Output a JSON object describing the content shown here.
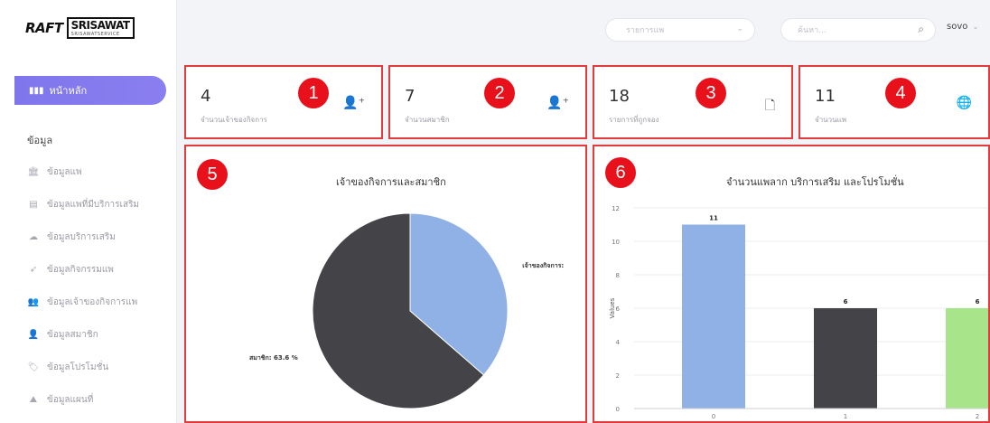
{
  "logo": {
    "raft": "RAFT",
    "brand": "SRISAWAT",
    "sub": "SRISAWATSERVICE"
  },
  "sidebar": {
    "home": {
      "icon": "bar-chart-icon",
      "label": "หน้าหลัก"
    },
    "section": "ข้อมูล",
    "items": [
      {
        "icon": "bank-icon",
        "label": "ข้อมูลแพ"
      },
      {
        "icon": "document-icon",
        "label": "ข้อมูลแพที่มีบริการเสริม"
      },
      {
        "icon": "cloud-icon",
        "label": "ข้อมูลบริการเสริม"
      },
      {
        "icon": "rocket-icon",
        "label": "ข้อมูลกิจกรรมแพ"
      },
      {
        "icon": "users-icon",
        "label": "ข้อมูลเจ้าของกิจการแพ"
      },
      {
        "icon": "user-icon",
        "label": "ข้อมูลสมาชิก"
      },
      {
        "icon": "tag-icon",
        "label": "ข้อมูลโปรโมชั่น"
      },
      {
        "icon": "map-icon",
        "label": "ข้อมูลแผนที่"
      }
    ]
  },
  "topbar": {
    "select_value": "รายการแพ",
    "search_placeholder": "ค้นหา...",
    "user": "sovo"
  },
  "stats": [
    {
      "badge": "1",
      "value": "4",
      "label": "จำนวนเจ้าของกิจการ",
      "icon": "user-plus-icon"
    },
    {
      "badge": "2",
      "value": "7",
      "label": "จำนวนสมาชิก",
      "icon": "user-plus-icon"
    },
    {
      "badge": "3",
      "value": "18",
      "label": "รายการที่ถูกจอง",
      "icon": "file-plus-icon"
    },
    {
      "badge": "4",
      "value": "11",
      "label": "จำนวนแพ",
      "icon": "globe-icon"
    }
  ],
  "pie": {
    "badge": "5",
    "chart_data": {
      "type": "pie",
      "title": "เจ้าของกิจการและสมาชิก",
      "slices": [
        {
          "name": "เจ้าของกิจการ:",
          "value": 36.4,
          "color": "#8fb1e6"
        },
        {
          "name": "สมาชิก",
          "value": 63.6,
          "color": "#434348"
        }
      ],
      "labels": [
        "เจ้าของกิจการ:",
        "สมาชิก: 63.6 %"
      ]
    }
  },
  "bar": {
    "badge": "6",
    "chart_data": {
      "type": "bar",
      "title": "จำนวนแพลาก บริการเสริม และโปรโมชั่น",
      "ylabel": "Values",
      "categories": [
        "0",
        "1",
        "2"
      ],
      "values": [
        11,
        6,
        6
      ],
      "colors": [
        "#8fb1e6",
        "#434348",
        "#a8e48a"
      ],
      "ylim": [
        0,
        12
      ],
      "yticks": [
        "0",
        "2",
        "4",
        "6",
        "8",
        "10",
        "12"
      ]
    }
  }
}
